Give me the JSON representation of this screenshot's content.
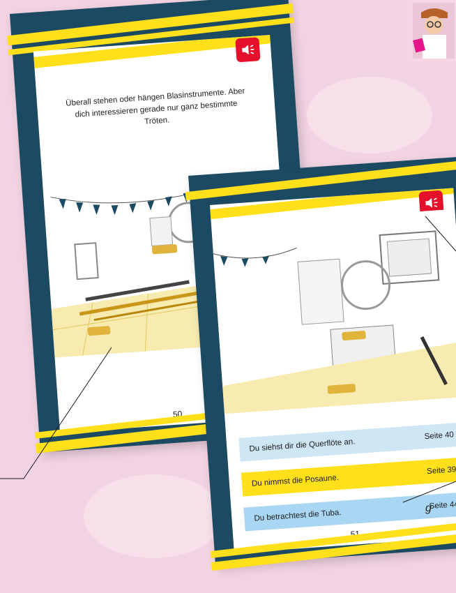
{
  "left_page": {
    "intro_text": "Überall stehen oder hängen Blasinstrumente. Aber dich interessieren gerade nur ganz bestimmte Tröten.",
    "page_number": "50",
    "speaker_icon": "speaker-icon"
  },
  "right_page": {
    "page_number": "51",
    "speaker_icon": "speaker-icon",
    "choices": [
      {
        "text": "Du siehst dir die Querflöte an.",
        "page": "Seite 40"
      },
      {
        "text": "Du nimmst die Posaune.",
        "page": "Seite 39"
      },
      {
        "text": "Du betrachtest die Tuba.",
        "page": "Seite 44"
      }
    ]
  },
  "caption": "g",
  "colors": {
    "background": "#f2d3e2",
    "book_frame": "#1d4a63",
    "accent_yellow": "#ffe01a",
    "speaker_red": "#e5112b",
    "choice_light_blue": "#cfe6f5",
    "choice_blue": "#a9d6f2"
  }
}
